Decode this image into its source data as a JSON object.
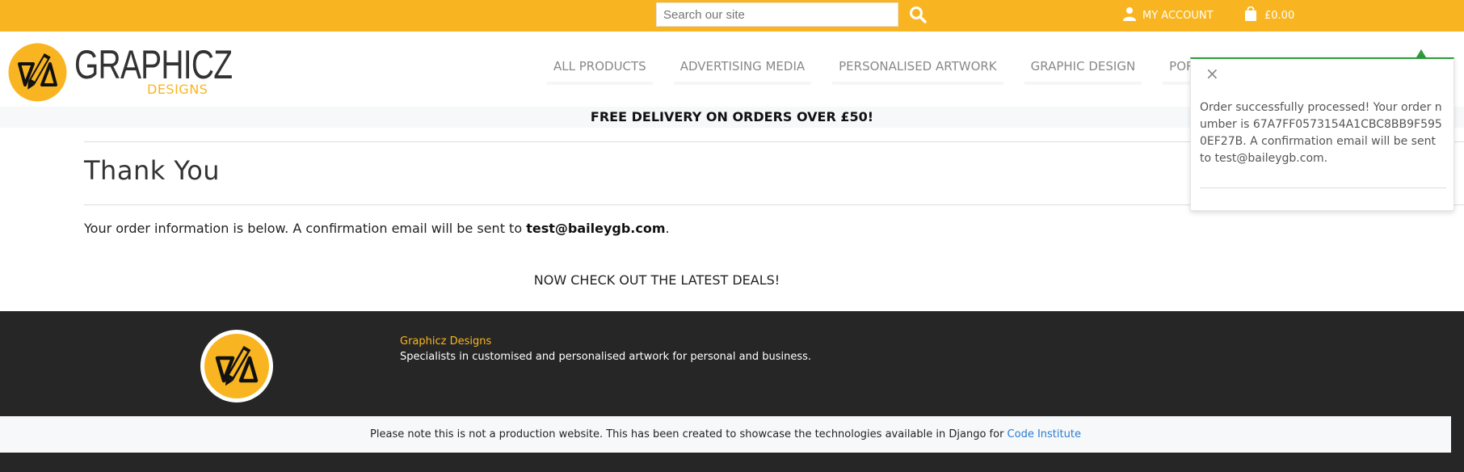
{
  "topbar": {
    "search_placeholder": "Search our site",
    "account_label": "MY ACCOUNT",
    "bag_total": "£0.00"
  },
  "brand": {
    "name": "GRAPHICZ",
    "subtitle": "DESIGNS"
  },
  "nav": {
    "items": [
      "ALL PRODUCTS",
      "ADVERTISING MEDIA",
      "PERSONALISED ARTWORK",
      "GRAPHIC DESIGN",
      "POR"
    ]
  },
  "banner": {
    "text": "FREE DELIVERY ON ORDERS OVER £50!"
  },
  "main": {
    "title": "Thank You",
    "info_prefix": "Your order information is below. A confirmation email will be sent to ",
    "email": "test@baileygb.com",
    "info_suffix": ".",
    "deals_text": "NOW CHECK OUT THE LATEST DEALS!"
  },
  "footer": {
    "name": "Graphicz Designs",
    "tagline": "Specialists in customised and personalised artwork for personal and business.",
    "note_text": "Please note this is not a production website. This has been created to showcase the technologies available in Django for ",
    "note_link": "Code Institute"
  },
  "toast": {
    "close_symbol": "×",
    "message": "Order successfully processed! Your order number is 67A7FF0573154A1CBC8BB9F5950EF27B. A confirmation email will be sent to test@baileygb.com."
  },
  "colors": {
    "accent": "#f9b521",
    "footer_bg": "#262626",
    "success": "#2f9b3d",
    "link": "#2a7bd0"
  }
}
